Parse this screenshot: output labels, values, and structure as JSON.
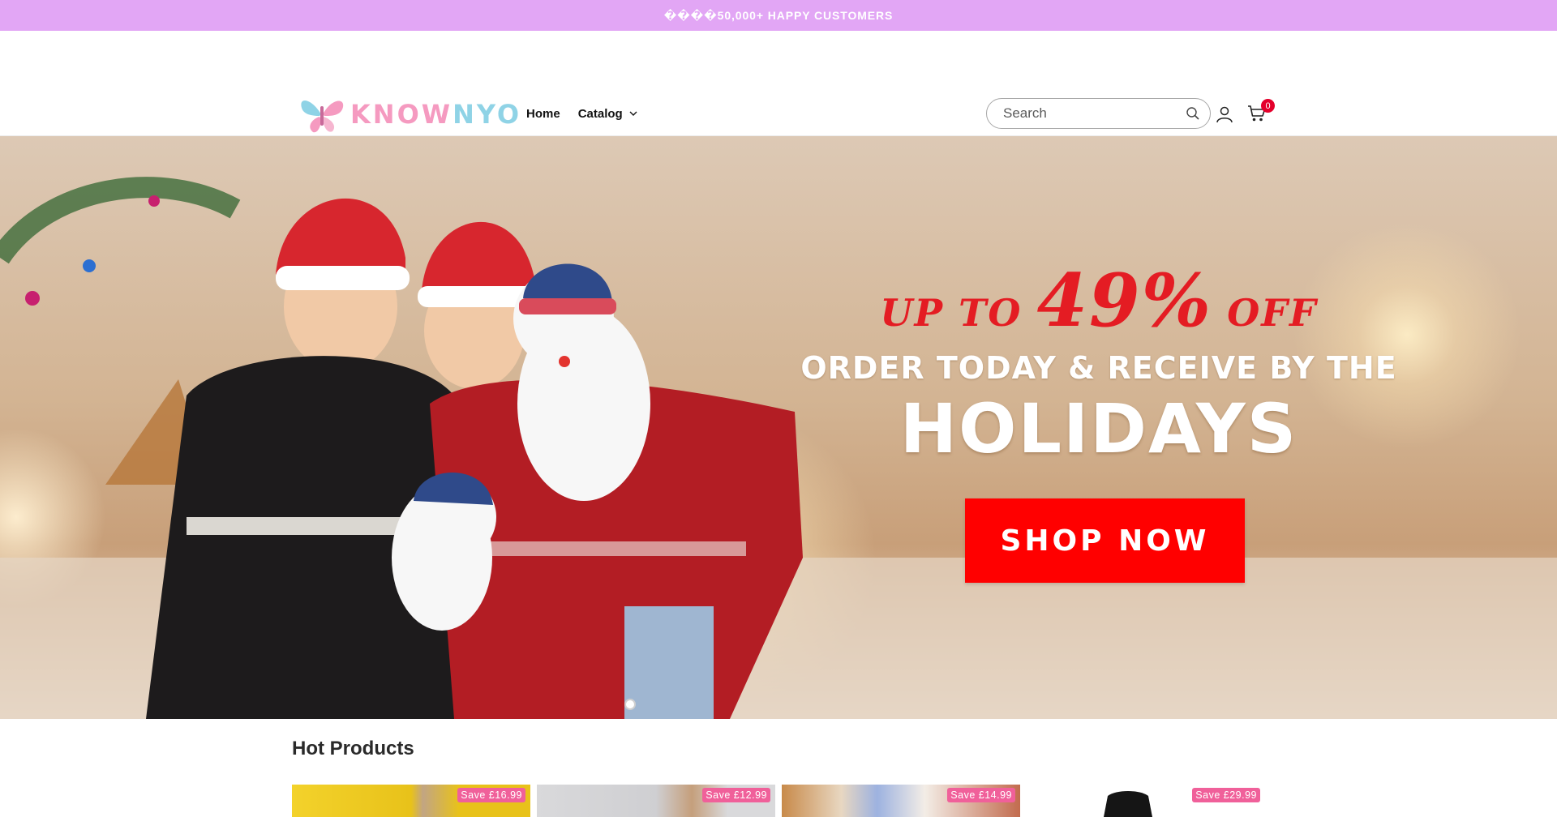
{
  "announcement": {
    "text": "����50,000+ HAPPY CUSTOMERS"
  },
  "header": {
    "logo": {
      "first": "KNOW",
      "second": "NYO"
    },
    "nav": [
      {
        "label": "Home"
      },
      {
        "label": "Catalog"
      }
    ],
    "search": {
      "placeholder": "Search",
      "value": ""
    },
    "cart_count": "0"
  },
  "hero": {
    "line1_prefix": "UP TO",
    "line1_percent": "49%",
    "line1_suffix": "OFF",
    "line2": "ORDER TODAY & RECEIVE BY THE",
    "line3": "HOLIDAYS",
    "cta": "SHOP NOW",
    "slide_count": 1
  },
  "hot_products": {
    "title": "Hot Products",
    "items": [
      {
        "save": "Save £16.99"
      },
      {
        "save": "Save £12.99"
      },
      {
        "save": "Save £14.99"
      },
      {
        "save": "Save £29.99"
      }
    ]
  },
  "colors": {
    "announcement_bg": "#e2a6f5",
    "cta_red": "#ff0000",
    "headline_red": "#e41c23",
    "badge_red": "#e4002b",
    "save_pink": "#f0609a"
  }
}
